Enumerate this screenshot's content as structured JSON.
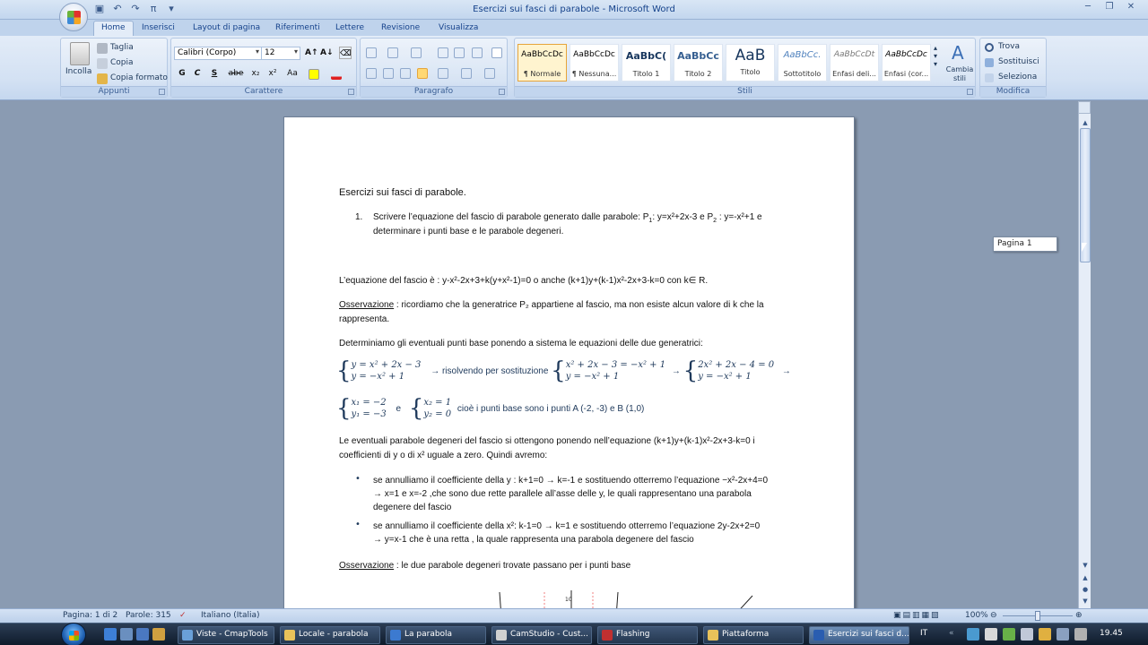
{
  "window": {
    "title": "Esercizi sui fasci di parabole - Microsoft Word"
  },
  "tabs": [
    "Home",
    "Inserisci",
    "Layout di pagina",
    "Riferimenti",
    "Lettere",
    "Revisione",
    "Visualizza"
  ],
  "clipboard": {
    "paste": "Incolla",
    "cut": "Taglia",
    "copy": "Copia",
    "format_painter": "Copia formato",
    "label": "Appunti"
  },
  "font": {
    "name": "Calibri (Corpo)",
    "size": "12",
    "label": "Carattere",
    "buttons": [
      "G",
      "C",
      "S",
      "abe",
      "x₂",
      "x²",
      "Aa"
    ]
  },
  "paragraph": {
    "label": "Paragrafo"
  },
  "styles": {
    "label": "Stili",
    "items": [
      {
        "sample": "AaBbCcDc",
        "name": "¶ Normale"
      },
      {
        "sample": "AaBbCcDc",
        "name": "¶ Nessuna..."
      },
      {
        "sample": "AaBbC(",
        "name": "Titolo 1"
      },
      {
        "sample": "AaBbCc",
        "name": "Titolo 2"
      },
      {
        "sample": "AaB",
        "name": "Titolo"
      },
      {
        "sample": "AaBbCc.",
        "name": "Sottotitolo"
      },
      {
        "sample": "AaBbCcDt",
        "name": "Enfasi deli..."
      },
      {
        "sample": "AaBbCcDc",
        "name": "Enfasi (cor..."
      }
    ],
    "change": "Cambia stili"
  },
  "editing": {
    "label": "Modifica",
    "find": "Trova",
    "replace": "Sostituisci",
    "select": "Seleziona"
  },
  "document": {
    "heading": "Esercizi sui fasci di parabole.",
    "item1_num": "1.",
    "item1_a": "Scrivere l’equazione del fascio di parabole generato dalle parabole: P",
    "item1_b": ": y=x²+2x-3 e P",
    "item1_c": " : y=-x²+1 e",
    "item1_d": "determinare i punti base e le parabole degeneri.",
    "sub1": "1",
    "sub2": "2",
    "eq_fascio": "L’equazione del fascio è :   y-x²-2x+3+k(y+x²-1)=0 o anche  (k+1)y+(k-1)x²-2x+3-k=0  con k∈ R.",
    "obs_label": "Osservazione",
    "obs1_rest": " : ricordiamo che la generatrice P₂ appartiene al fascio, ma non esiste alcun valore di k che la",
    "obs1_line2": "rappresenta.",
    "det_line": "Determiniamo gli eventuali punti base ponendo a sistema le equazioni delle due generatrici:",
    "sys1_a": "y = x² + 2x − 3",
    "sys1_b": "y = −x² + 1",
    "arrow_text": "→ risolvendo per sostituzione",
    "sys2_a": "x² + 2x − 3 = −x² + 1",
    "sys2_b": "y = −x² + 1",
    "sys3_a": "2x² + 2x − 4 = 0",
    "sys3_b": "y = −x² + 1",
    "arrow": "→",
    "sys4_a": "x₁ = −2",
    "sys4_b": "y₁ = −3",
    "and": "e",
    "sys5_a": "x₂ = 1",
    "sys5_b": "y₂ = 0",
    "base_points": "cioè i punti base sono i punti A (-2, -3) e B (1,0)",
    "deg_line1": "Le eventuali parabole degeneri del fascio si ottengono ponendo nell’equazione (k+1)y+(k-1)x²-2x+3-k=0  i",
    "deg_line2": "coefficienti di y o di x² uguale a zero. Quindi avremo:",
    "b1_l1": "se annulliamo il coefficiente della y : k+1=0 → k=-1 e sostituendo otterremo l’equazione −x²-2x+4=0",
    "b1_l2": "→ x=1 e x=-2 ,che sono due rette parallele all’asse delle y, le quali rappresentano una parabola",
    "b1_l3": "degenere del fascio",
    "b2_l1": "se annulliamo il coefficiente della x²: k-1=0 → k=1 e sostituendo otterremo l’equazione 2y-2x+2=0",
    "b2_l2": "→ y=x-1 che è una retta , la quale rappresenta una parabola degenere del fascio",
    "obs2_rest": " : le due parabole degeneri trovate passano per i punti base",
    "chart_tick": "10"
  },
  "page_tooltip": "Pagina 1",
  "status": {
    "page": "Pagina: 1 di 2",
    "words": "Parole: 315",
    "language": "Italiano (Italia)",
    "zoom": "100%"
  },
  "taskbar": {
    "items": [
      {
        "label": "Viste - CmapTools",
        "color": "#6aa0d8"
      },
      {
        "label": "Locale - parabola",
        "color": "#e8c25a"
      },
      {
        "label": "La parabola",
        "color": "#3c7ad0"
      },
      {
        "label": "CamStudio - Cust...",
        "color": "#d0d0d0"
      },
      {
        "label": "Flashing",
        "color": "#c03030"
      },
      {
        "label": "Piattaforma",
        "color": "#e8c25a"
      },
      {
        "label": "Esercizi sui fasci d...",
        "color": "#2a5db0"
      }
    ],
    "lang": "IT",
    "time": "19.45"
  }
}
